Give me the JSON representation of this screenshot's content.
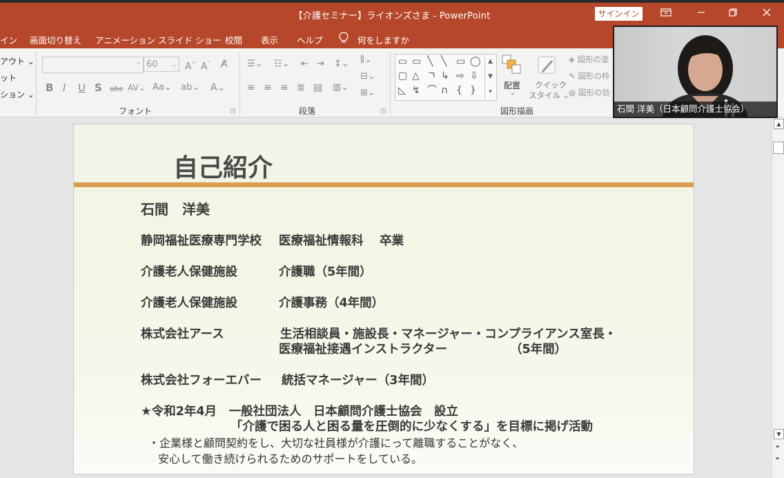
{
  "window": {
    "title": "【介護セミナー】ライオンズさま  -  PowerPoint",
    "signin_label": "サインイン",
    "ribbon_display_icon": "ribbon-display-icon",
    "minimize_icon": "minimize-icon",
    "restore_icon": "restore-icon",
    "close_icon": "close-icon"
  },
  "menu": {
    "items": [
      "イン",
      "画面切り替え",
      "アニメーション",
      "スライド ショー",
      "校閲",
      "表示",
      "ヘルプ"
    ],
    "tellme": "何をしますか"
  },
  "ribbon": {
    "left_items": [
      "アウト ⌄",
      "ット",
      "ション ⌄"
    ],
    "font": {
      "name": "",
      "size": "60",
      "label": "フォント"
    },
    "paragraph_label": "段落",
    "drawing": {
      "label": "図形描画",
      "arrange_label": "配置",
      "quick_style_line1": "クイック",
      "quick_style_line2": "スタイル ⌄",
      "right_items": [
        "図形の塗",
        "図形の枠",
        "図形の効"
      ]
    }
  },
  "video": {
    "caption": "石間 洋美（日本顧問介護士協会）"
  },
  "slide": {
    "title": "自己紹介",
    "name": "石間　洋美",
    "lines": [
      {
        "left": "静岡福祉医療専門学校",
        "right": "医療福祉情報科　 卒業"
      },
      {
        "left": "介護老人保健施設",
        "right": "介護職（5年間）"
      },
      {
        "left": "介護老人保健施設",
        "right": "介護事務（4年間）"
      },
      {
        "left": "株式会社アース",
        "right": "生活相談員・施設長・マネージャー・コンプライアンス室長・"
      },
      {
        "left": "",
        "right": "医療福祉接遇インストラクター"
      },
      {
        "left": "",
        "right": "（5年間）"
      },
      {
        "left": "株式会社フォーエバー",
        "right": "統括マネージャー（3年間）"
      }
    ],
    "founding": "★令和2年4月　一般社団法人　日本顧問介護士協会　設立",
    "mission": "「介護で困る人と困る量を圧倒的に少なくする」を目標に掲げ活動",
    "note1": "・企業様と顧問契約をし、大切な社員様が介護にって離職することがなく、",
    "note2": "安心して働き続けられるためのサポートをしている。"
  },
  "colors": {
    "titlebar": "#b7472a",
    "ribbon": "#f3f3f3",
    "accent_bar": "#dc9c52",
    "slide_text": "#3b3b3b"
  }
}
